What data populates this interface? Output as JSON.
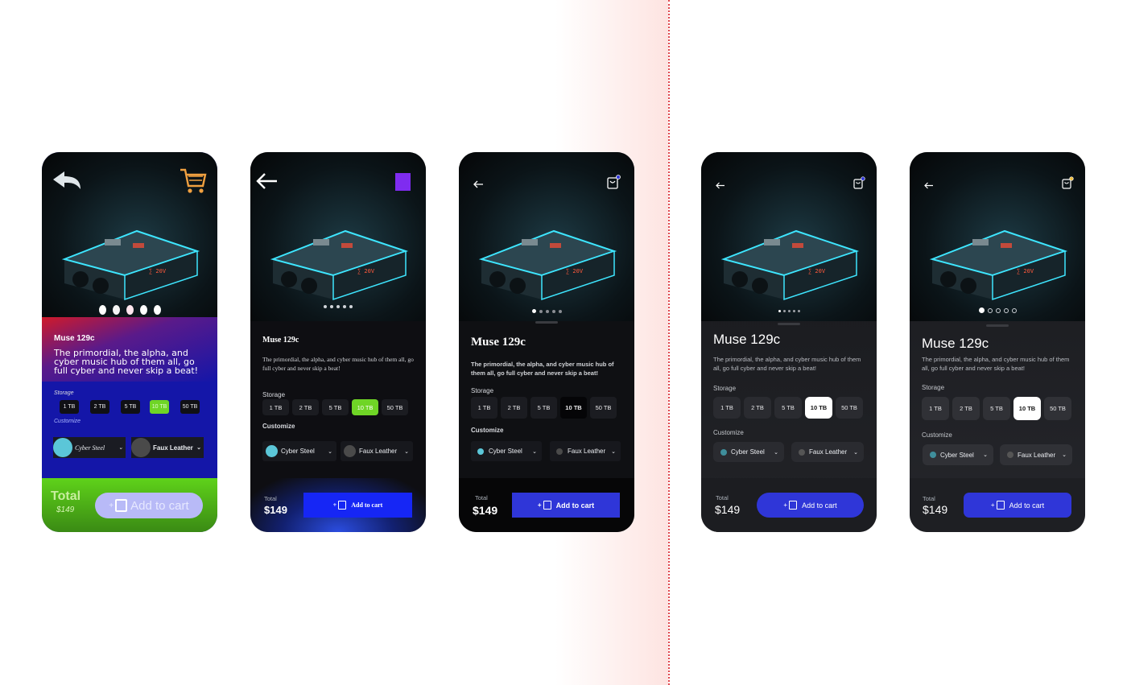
{
  "product": {
    "name": "Muse 129c",
    "description": "The primordial, the alpha, and cyber music hub of them all, go full cyber and never skip a beat!"
  },
  "storage": {
    "label": "Storage",
    "options": [
      "1 TB",
      "2 TB",
      "5 TB",
      "10 TB",
      "50 TB"
    ],
    "selected": "10 TB"
  },
  "customize": {
    "label": "Customize",
    "options": [
      "Cyber Steel",
      "Faux Leather"
    ]
  },
  "total": {
    "label": "Total",
    "price": "$149"
  },
  "cta": {
    "label": "Add to cart"
  },
  "icons": {
    "back": "arrow-left-icon",
    "cart": "shopping-bag-icon",
    "cart_alt": "shopping-cart-icon",
    "chevron": "chevron-down-icon",
    "plus": "plus-icon"
  },
  "colors": {
    "accent_blue": "#2f36d8",
    "lime": "#6fd526",
    "cyber_steel": "#5bc6d8",
    "faux_leather": "#4a4a4a",
    "divider_red": "#e0484e"
  }
}
